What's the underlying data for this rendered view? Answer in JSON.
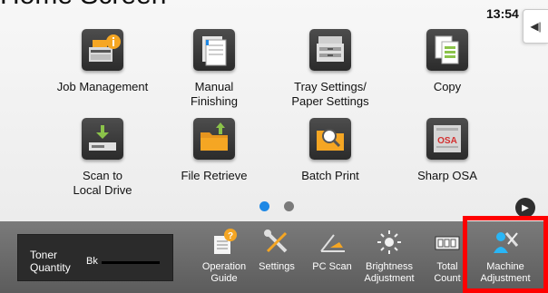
{
  "page_heading": "Home Screen",
  "status": {
    "time": "13:54"
  },
  "side_tab": {
    "glyph": "◀|"
  },
  "apps": [
    {
      "id": "job-management",
      "label": "Job Management",
      "label2": "",
      "icon": "job-management-icon"
    },
    {
      "id": "manual-finishing",
      "label": "Manual",
      "label2": "Finishing",
      "icon": "manual-finishing-icon"
    },
    {
      "id": "tray-settings",
      "label": "Tray Settings/",
      "label2": "Paper Settings",
      "icon": "tray-settings-icon"
    },
    {
      "id": "copy",
      "label": "Copy",
      "label2": "",
      "icon": "copy-icon"
    },
    {
      "id": "scan-to-local-drive",
      "label": "Scan to",
      "label2": "Local Drive",
      "icon": "scan-to-local-drive-icon"
    },
    {
      "id": "file-retrieve",
      "label": "File Retrieve",
      "label2": "",
      "icon": "file-retrieve-icon"
    },
    {
      "id": "batch-print",
      "label": "Batch Print",
      "label2": "",
      "icon": "batch-print-icon"
    },
    {
      "id": "sharp-osa",
      "label": "Sharp OSA",
      "label2": "",
      "icon": "sharp-osa-icon"
    }
  ],
  "pager": {
    "pages": 2,
    "current": 1,
    "next_glyph": "▶"
  },
  "toner": {
    "label1": "Toner",
    "label2": "Quantity",
    "color_code": "Bk",
    "level_fraction": 1.0
  },
  "bottom_bar": [
    {
      "id": "operation-guide",
      "label": "Operation",
      "label2": "Guide",
      "icon": "operation-guide-icon"
    },
    {
      "id": "settings",
      "label": "Settings",
      "label2": "",
      "icon": "settings-icon"
    },
    {
      "id": "pc-scan",
      "label": "PC Scan",
      "label2": "",
      "icon": "pc-scan-icon"
    },
    {
      "id": "brightness-adjustment",
      "label": "Brightness",
      "label2": "Adjustment",
      "icon": "brightness-icon"
    },
    {
      "id": "total-count",
      "label": "Total",
      "label2": "Count",
      "icon": "total-count-icon"
    },
    {
      "id": "machine-adjustment",
      "label": "Machine",
      "label2": "Adjustment",
      "icon": "machine-adjustment-icon"
    }
  ],
  "colors": {
    "accent": "#1e88e5",
    "highlight": "#ff0000",
    "bar": "#6b6b6b",
    "icon_orange": "#f5a623",
    "icon_green": "#8bc34a"
  }
}
